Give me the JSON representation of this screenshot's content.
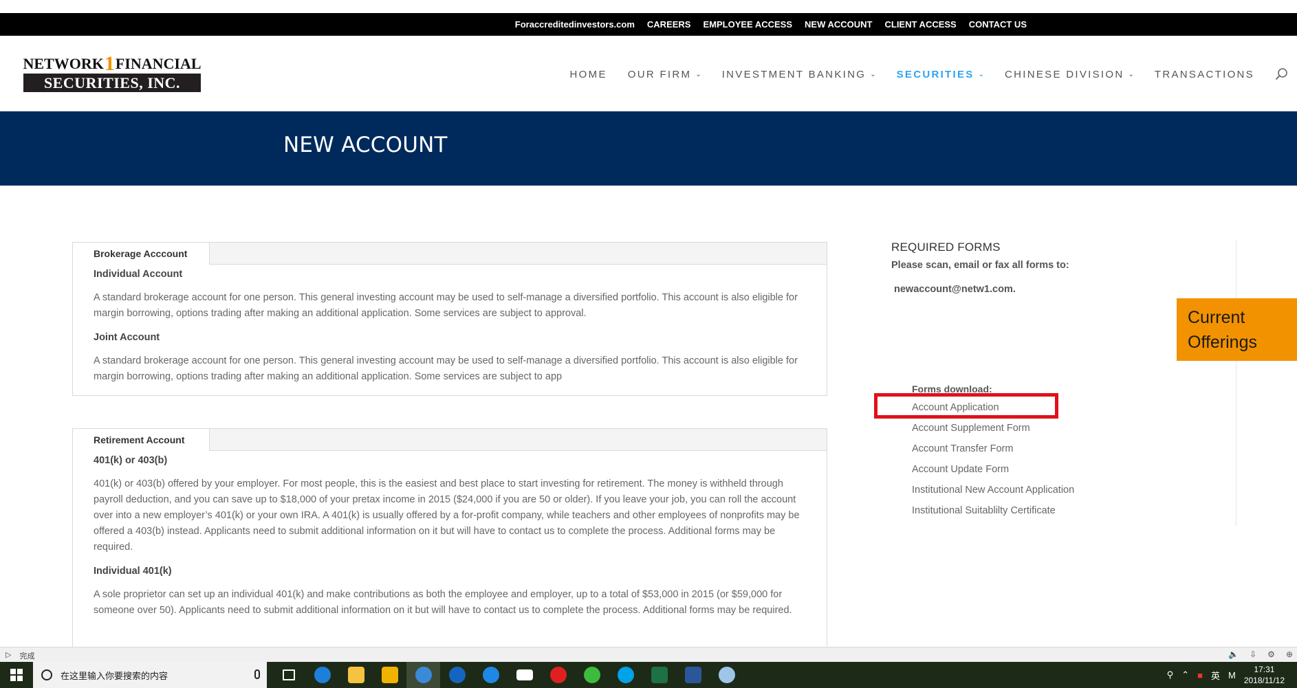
{
  "topbar": {
    "links": [
      "Foraccreditedinvestors.com",
      "CAREERS",
      "EMPLOYEE ACCESS",
      "NEW ACCOUNT",
      "CLIENT ACCESS",
      "CONTACT US"
    ]
  },
  "logo": {
    "line1_left": "NETWORK",
    "line1_mark": "1",
    "line1_right": "FINANCIAL",
    "line2": "SECURITIES, INC."
  },
  "nav": {
    "items": [
      {
        "label": "HOME",
        "dropdown": false
      },
      {
        "label": "OUR FIRM",
        "dropdown": true
      },
      {
        "label": "INVESTMENT BANKING",
        "dropdown": true
      },
      {
        "label": "SECURITIES",
        "dropdown": true,
        "active": true
      },
      {
        "label": "CHINESE DIVISION",
        "dropdown": true
      },
      {
        "label": "TRANSACTIONS",
        "dropdown": false
      }
    ],
    "search_icon": "search-icon"
  },
  "banner": {
    "title": "NEW ACCOUNT"
  },
  "brokerage": {
    "tab": "Brokerage Acccount",
    "sections": [
      {
        "heading": "Individual Account",
        "text": "A standard brokerage account for one person. This general investing account may be used to self-manage a diversified portfolio. This account is also eligible for margin borrowing, options trading after making an additional application. Some services are subject to approval."
      },
      {
        "heading": "Joint Account",
        "text": "A standard brokerage account for one person. This general investing account may be used to self-manage a diversified portfolio. This account is also eligible for margin borrowing, options trading after making an additional application. Some services are subject to app"
      }
    ]
  },
  "retirement": {
    "tab": "Retirement Account",
    "sections": [
      {
        "heading": "401(k) or 403(b)",
        "text": "401(k) or 403(b) offered by your employer. For most people, this is the easiest and best place to start investing for retirement. The money is withheld through payroll deduction, and you can save up to $18,000 of your pretax income in 2015 ($24,000 if you are 50 or older). If you leave your job, you can roll the account over into a new employer’s 401(k) or your own IRA. A 401(k) is usually offered by a for-profit company, while teachers and other employees of nonprofits may be offered a 403(b) instead. Applicants need to submit additional information on it but will have to contact us to complete the process.  Additional forms may be required."
      },
      {
        "heading": "Individual 401(k)",
        "text": "A sole proprietor can set up an individual 401(k) and make contributions as both the employee and employer, up to a total of $53,000 in 2015 (or $59,000 for someone over 50). Applicants need to submit additional information on it but will have to contact us to complete the process.  Additional forms may be required."
      }
    ]
  },
  "sidebar": {
    "title": "REQUIRED FORMS",
    "note": "Please scan, email or fax all forms to:",
    "email": "newaccount@netw1.com.",
    "forms_label": "Forms download:",
    "forms": [
      "Account Application",
      "Account Supplement Form",
      "Account Transfer Form",
      "Account Update Form",
      "Institutional New Account Application",
      "Institutional Suitablilty Certificate"
    ]
  },
  "offers": {
    "label": "Current Offerings"
  },
  "statusbar": {
    "status": "完成"
  },
  "taskbar": {
    "search_placeholder": "在这里输入你要搜索的内容",
    "ime": "英",
    "ime2": "M",
    "time": "17:31",
    "date": "2018/11/12"
  },
  "colors": {
    "banner": "#002a5c",
    "accent": "#2ea3f2",
    "offers": "#f39200",
    "highlight": "#e0101c"
  }
}
